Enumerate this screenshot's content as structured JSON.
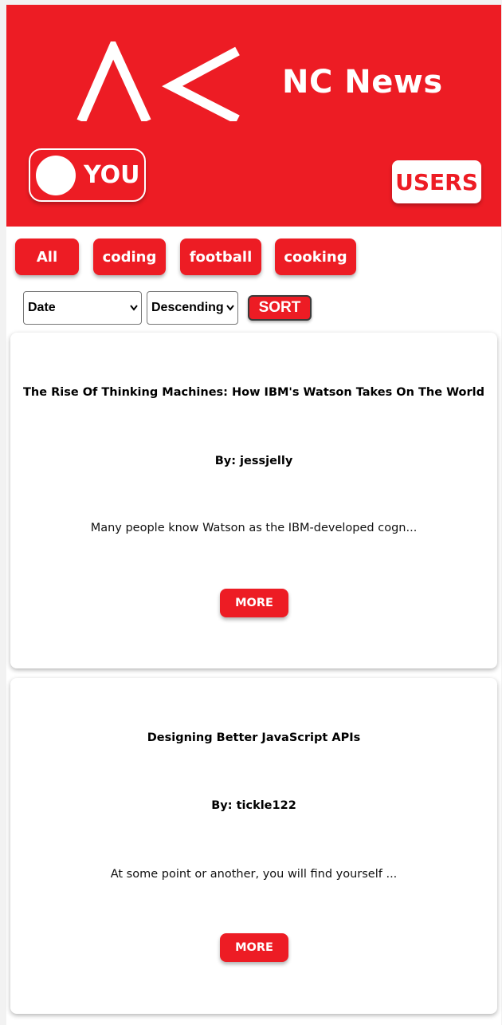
{
  "header": {
    "logo_icon": "nc-logo-icon",
    "brand_name": "NC News",
    "user_button_label": "YOU",
    "users_button_label": "USERS",
    "accent_color": "#ed1c24"
  },
  "topics": [
    {
      "label": "All"
    },
    {
      "label": "coding"
    },
    {
      "label": "football"
    },
    {
      "label": "cooking"
    }
  ],
  "sort": {
    "sort_by_selected": "Date",
    "order_selected": "Descending",
    "button_label": "SORT"
  },
  "articles": [
    {
      "title": "The Rise Of Thinking Machines: How IBM's Watson Takes On The World",
      "author": "By: jessjelly",
      "snippet": "Many people know Watson as the IBM-developed cogn...",
      "more_label": "MORE"
    },
    {
      "title": "Designing Better JavaScript APIs",
      "author": "By: tickle122",
      "snippet": "At some point or another, you will find yourself ...",
      "more_label": "MORE"
    }
  ]
}
